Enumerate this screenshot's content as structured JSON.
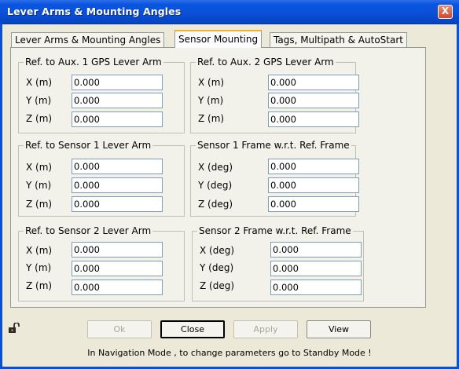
{
  "window": {
    "title": "Lever Arms & Mounting Angles",
    "close_label": "X"
  },
  "tabs": [
    {
      "label": "Lever Arms & Mounting Angles",
      "active": false
    },
    {
      "label": "Sensor Mounting",
      "active": true
    },
    {
      "label": "Tags, Multipath & AutoStart",
      "active": false
    }
  ],
  "groups": {
    "aux1": {
      "title": "Ref. to Aux. 1 GPS Lever Arm",
      "rows": [
        {
          "label": "X (m)",
          "value": "0.000"
        },
        {
          "label": "Y (m)",
          "value": "0.000"
        },
        {
          "label": "Z (m)",
          "value": "0.000"
        }
      ]
    },
    "aux2": {
      "title": "Ref. to Aux. 2 GPS Lever Arm",
      "rows": [
        {
          "label": "X (m)",
          "value": "0.000"
        },
        {
          "label": "Y (m)",
          "value": "0.000"
        },
        {
          "label": "Z (m)",
          "value": "0.000"
        }
      ]
    },
    "sensor1_lever": {
      "title": "Ref. to Sensor 1 Lever Arm",
      "rows": [
        {
          "label": "X (m)",
          "value": "0.000"
        },
        {
          "label": "Y (m)",
          "value": "0.000"
        },
        {
          "label": "Z (m)",
          "value": "0.000"
        }
      ]
    },
    "sensor1_frame": {
      "title": "Sensor 1 Frame w.r.t. Ref. Frame",
      "rows": [
        {
          "label": "X (deg)",
          "value": "0.000"
        },
        {
          "label": "Y (deg)",
          "value": "0.000"
        },
        {
          "label": "Z (deg)",
          "value": "0.000"
        }
      ]
    },
    "sensor2_lever": {
      "title": "Ref. to Sensor 2 Lever Arm",
      "rows": [
        {
          "label": "X (m)",
          "value": "0.000"
        },
        {
          "label": "Y (m)",
          "value": "0.000"
        },
        {
          "label": "Z (m)",
          "value": "0.000"
        }
      ]
    },
    "sensor2_frame": {
      "title": "Sensor 2 Frame w.r.t. Ref. Frame",
      "rows": [
        {
          "label": "X (deg)",
          "value": "0.000"
        },
        {
          "label": "Y (deg)",
          "value": "0.000"
        },
        {
          "label": "Z (deg)",
          "value": "0.000"
        }
      ]
    }
  },
  "buttons": {
    "ok": "Ok",
    "close": "Close",
    "apply": "Apply",
    "view": "View"
  },
  "status": "In Navigation Mode , to change parameters go to Standby Mode !",
  "icons": {
    "lock": "lock-icon",
    "close": "close-icon"
  },
  "colors": {
    "titlebar": "#0a4fd6",
    "active_tab_highlight": "#f0b030",
    "dialog_bg": "#ece9d8"
  }
}
